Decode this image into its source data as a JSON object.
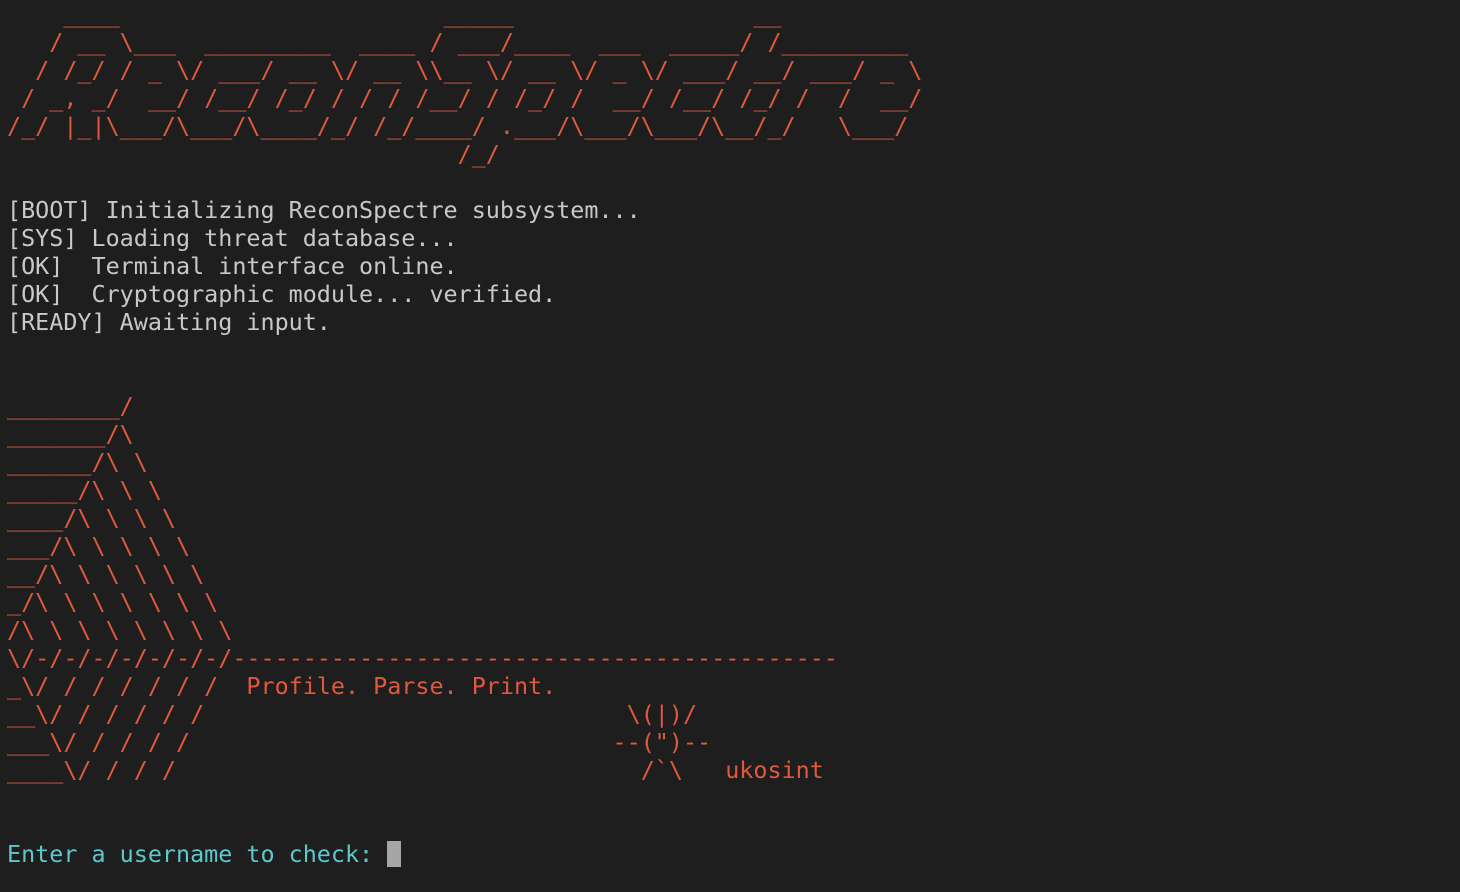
{
  "banner": {
    "lines": [
      "    ____                       _____                 __",
      "   / __ \\___  _________  ____ / ___/____  ___  _____/ /_________",
      "  / /_/ / _ \\/ ___/ __ \\/ __ \\\\__ \\/ __ \\/ _ \\/ ___/ __/ ___/ _ \\",
      " / _, _/  __/ /__/ /_/ / / / /__/ / /_/ /  __/ /__/ /_/ /  /  __/",
      "/_/ |_|\\___/\\___/\\____/_/ /_/____/ .___/\\___/\\___/\\__/_/   \\___/",
      "                                /_/"
    ]
  },
  "boot_log": [
    "[BOOT] Initializing ReconSpectre subsystem...",
    "[SYS] Loading threat database...",
    "[OK]  Terminal interface online.",
    "[OK]  Cryptographic module... verified.",
    "[READY] Awaiting input."
  ],
  "art": {
    "lines": [
      "________/",
      "_______/\\",
      "______/\\ \\",
      "_____/\\ \\ \\",
      "____/\\ \\ \\ \\",
      "___/\\ \\ \\ \\ \\",
      "__/\\ \\ \\ \\ \\ \\",
      "_/\\ \\ \\ \\ \\ \\ \\",
      "/\\ \\ \\ \\ \\ \\ \\ \\",
      "\\/-/-/-/-/-/-/-/-------------------------------------------",
      "_\\/ / / / / / /  Profile. Parse. Print.",
      "__\\/ / / / / /                              \\(|)/",
      "___\\/ / / / /                              --(\")--",
      "____\\/ / / /                                 /`\\   ukosint"
    ]
  },
  "prompt": {
    "label": "Enter a username to check: ",
    "value": ""
  }
}
